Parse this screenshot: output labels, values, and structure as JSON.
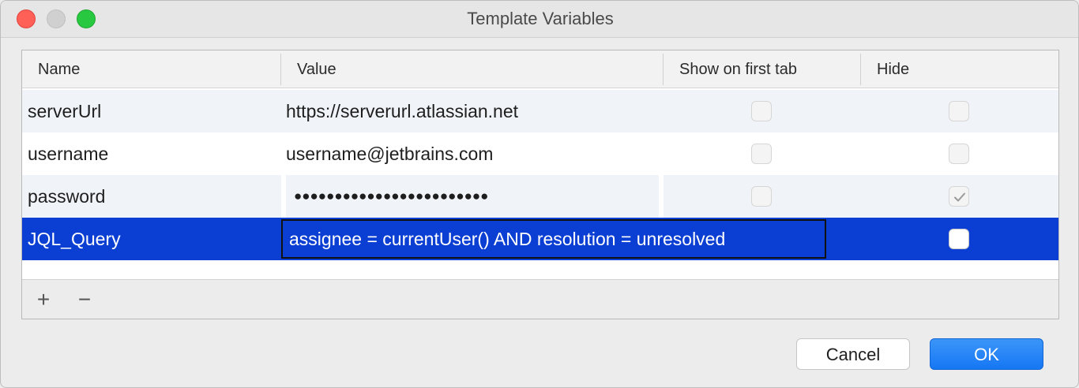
{
  "window": {
    "title": "Template Variables"
  },
  "table": {
    "columns": [
      "Name",
      "Value",
      "Show on first tab",
      "Hide"
    ],
    "rows": [
      {
        "name": "serverUrl",
        "value": "https://serverurl.atlassian.net",
        "show_on_first_tab": false,
        "hide": false
      },
      {
        "name": "username",
        "value": "username@jetbrains.com",
        "show_on_first_tab": false,
        "hide": false
      },
      {
        "name": "password",
        "value": "●●●●●●●●●●●●●●●●●●●●●●●●",
        "show_on_first_tab": false,
        "hide": true
      },
      {
        "name": "JQL_Query",
        "value": "assignee = currentUser() AND resolution = unresolved",
        "show_on_first_tab": false,
        "hide": false,
        "selected": true,
        "editing": true
      }
    ]
  },
  "toolbar": {
    "add_icon": "+",
    "remove_icon": "−"
  },
  "buttons": {
    "cancel": "Cancel",
    "ok": "OK"
  },
  "colors": {
    "selection": "#0b3fd3",
    "ok_button": "#1677f4",
    "close": "#fe5f57",
    "maximize": "#28c840"
  }
}
